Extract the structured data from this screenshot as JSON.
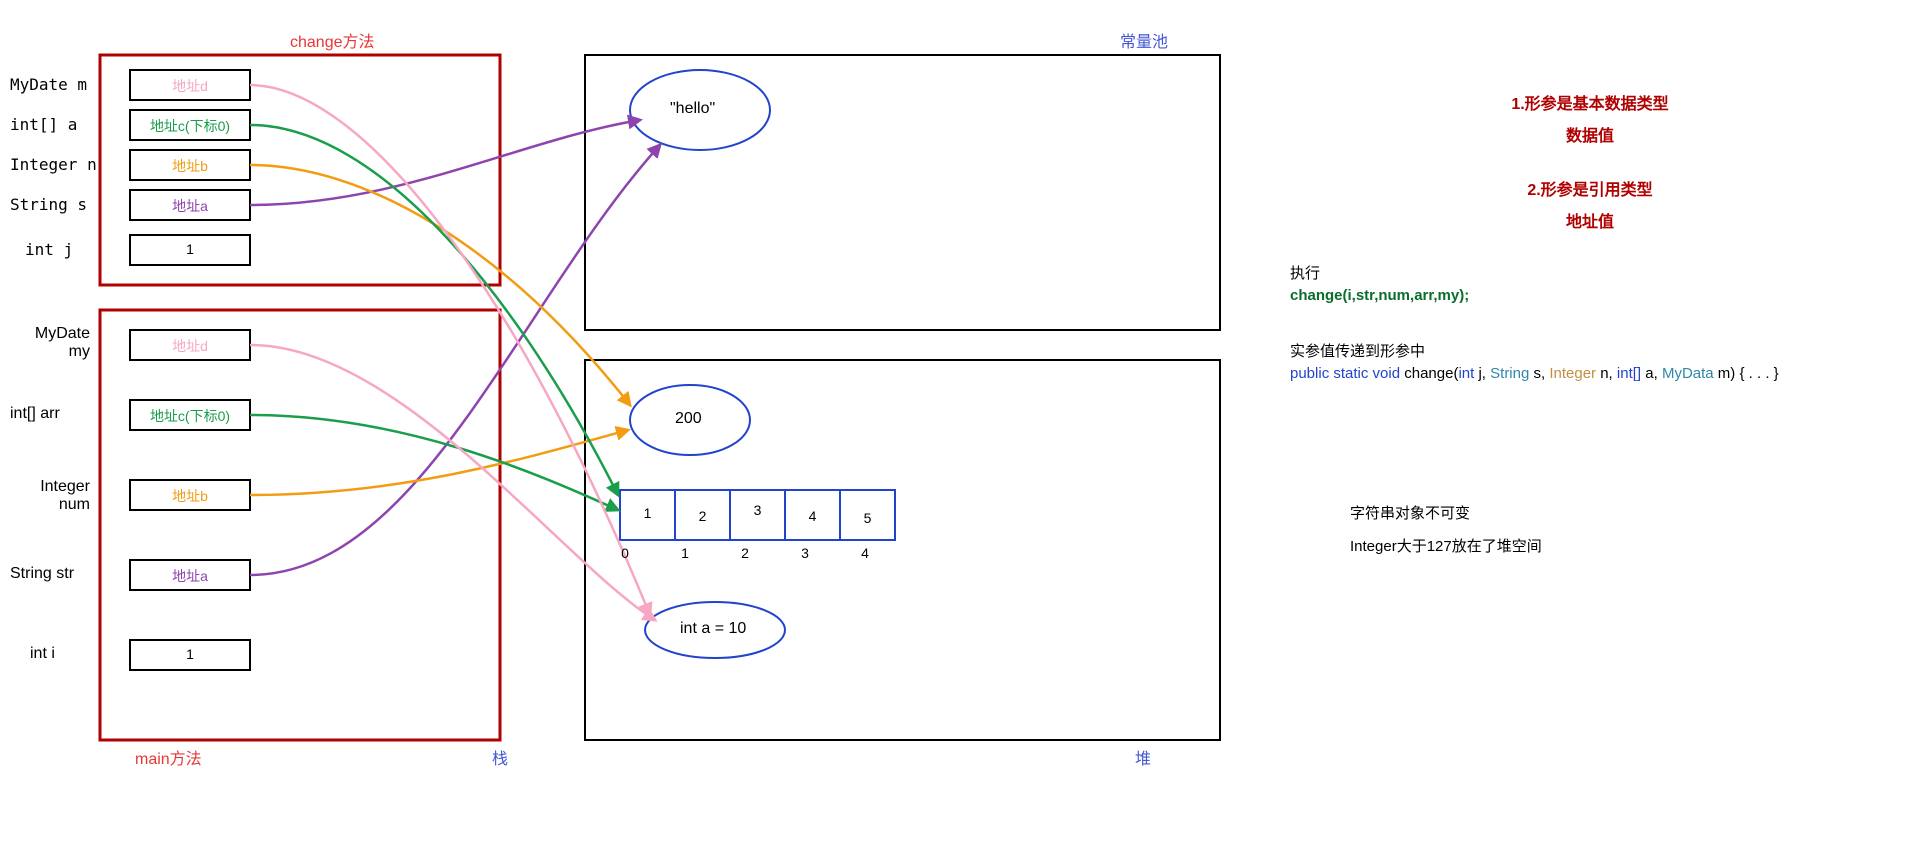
{
  "titles": {
    "change_method": "change方法",
    "main_method": "main方法",
    "stack": "栈",
    "heap": "堆",
    "const_pool": "常量池"
  },
  "stack_change": {
    "labels": [
      "MyDate m",
      "int[] a",
      "Integer n",
      "String s",
      "int j"
    ],
    "boxes": {
      "addr_d": "地址d",
      "addr_c": "地址c(下标0)",
      "addr_b": "地址b",
      "addr_a": "地址a",
      "one": "1"
    }
  },
  "stack_main": {
    "labels": [
      "MyDate my",
      "int[] arr",
      "Integer num",
      "String str",
      "int i"
    ],
    "boxes": {
      "addr_d": "地址d",
      "addr_c": "地址c(下标0)",
      "addr_b": "地址b",
      "addr_a": "地址a",
      "one": "1"
    }
  },
  "heap": {
    "hello": "\"hello\"",
    "two_hundred": "200",
    "int_a": "int a = 10",
    "array": [
      "1",
      "2",
      "3",
      "4",
      "5"
    ],
    "array_idx": [
      "0",
      "1",
      "2",
      "3",
      "4"
    ]
  },
  "right": {
    "h1": "1.形参是基本数据类型",
    "h1b": "数据值",
    "h2": "2.形参是引用类型",
    "h2b": "地址值",
    "exec": "执行",
    "call": "change(i,str,num,arr,my);",
    "pass_desc": "实参值传递到形参中",
    "sig_prefix": "public static void",
    "sig_name": " change",
    "sig_p1": "int",
    "sig_p1n": " j, ",
    "sig_p2": "String",
    "sig_p2n": " s, ",
    "sig_p3": "Integer",
    "sig_p3n": " n, ",
    "sig_p4": "int[]",
    "sig_p4n": " a, ",
    "sig_p5": "MyData",
    "sig_p5n": " m) { . . . }",
    "note1": "字符串对象不可变",
    "note2": "Integer大于127放在了堆空间"
  }
}
